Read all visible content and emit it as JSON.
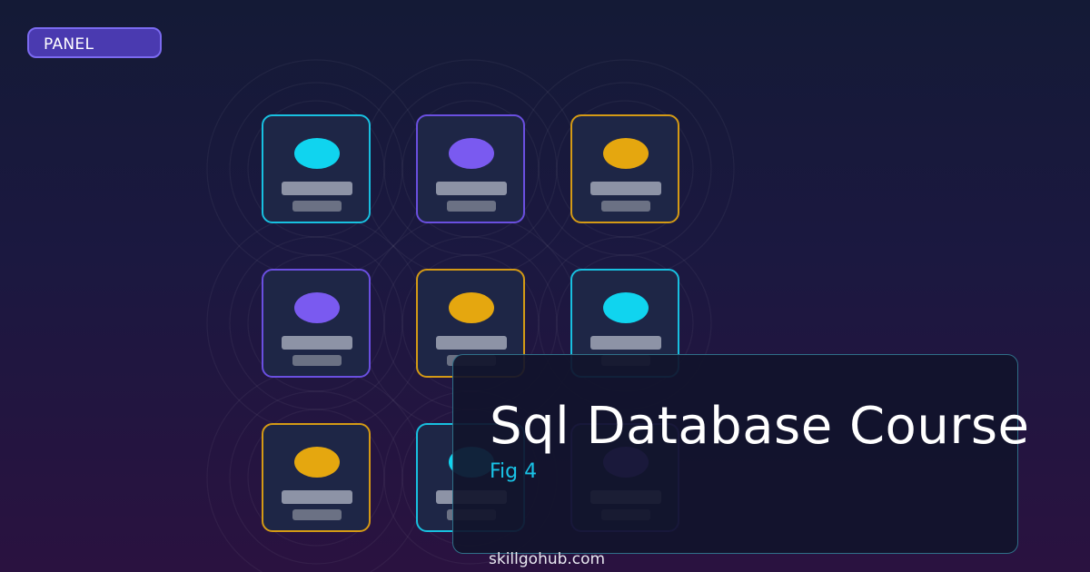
{
  "badge": {
    "label": "PANEL"
  },
  "title": "Sql Database Course",
  "subtitle": "Fig 4",
  "footer": "skillgohub.com",
  "colors": {
    "cyan": "#10d4ef",
    "purple": "#7a5af0",
    "amber": "#e5a70f",
    "title_box_border": "#2f6f88"
  },
  "grid": {
    "rows": [
      [
        "cyan",
        "purple",
        "amber"
      ],
      [
        "purple",
        "amber",
        "cyan"
      ],
      [
        "amber",
        "cyan",
        "purple"
      ]
    ]
  }
}
